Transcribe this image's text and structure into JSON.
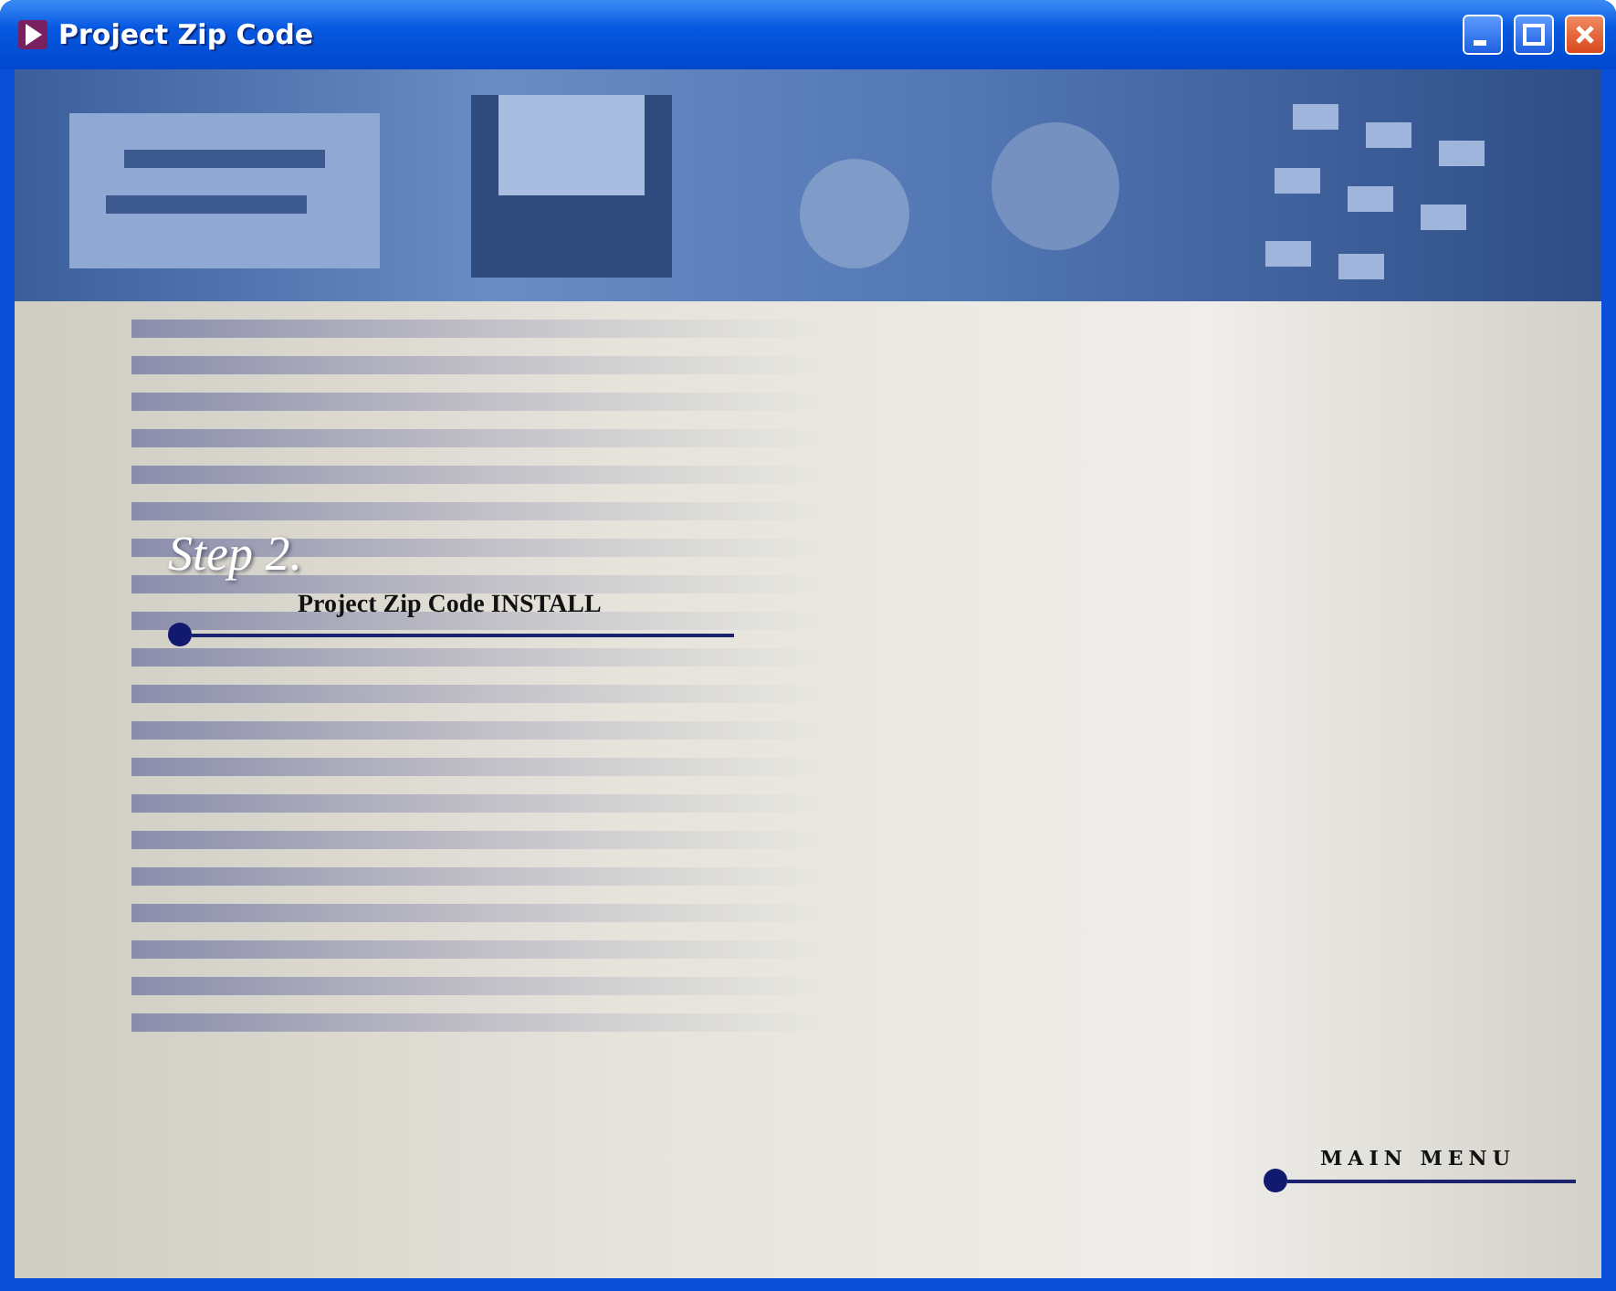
{
  "window": {
    "title": "Project Zip Code"
  },
  "step": {
    "heading": "Step 2.",
    "link": "Project Zip Code INSTALL"
  },
  "menu_link": "MAIN MENU"
}
